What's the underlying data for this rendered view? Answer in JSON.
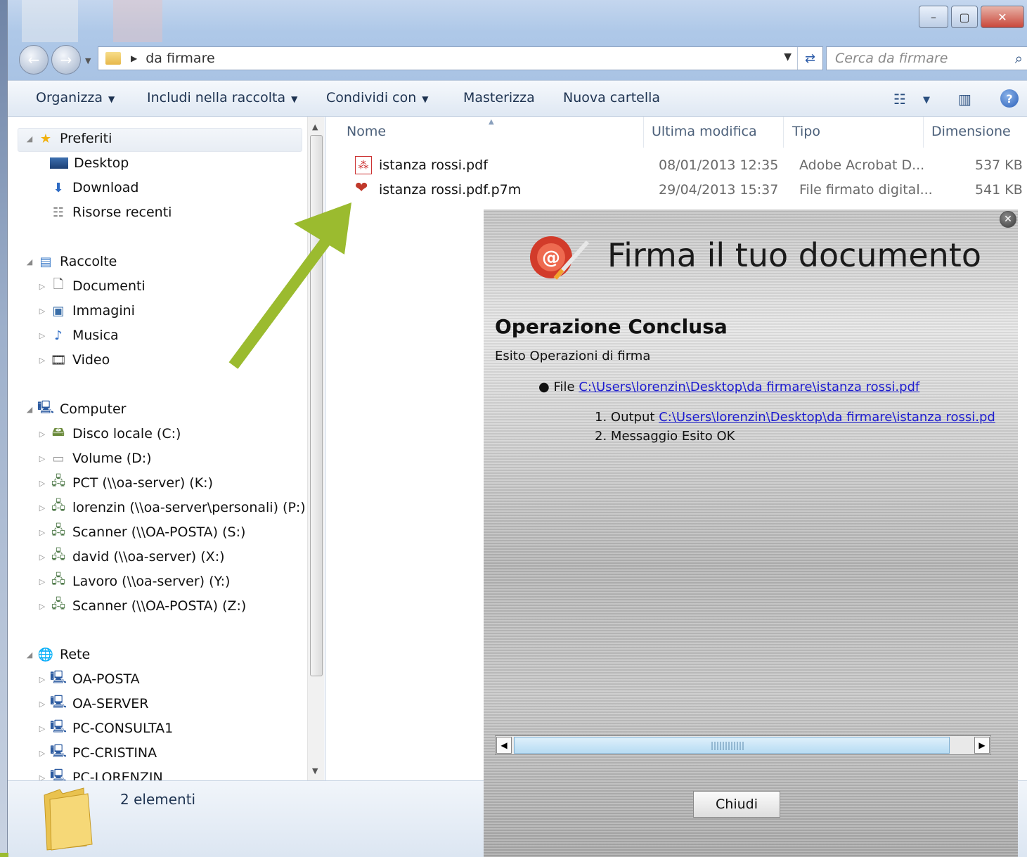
{
  "window": {
    "address_folder": "da firmare",
    "search_placeholder": "Cerca da firmare"
  },
  "toolbar": {
    "organize": "Organizza",
    "include": "Includi nella raccolta",
    "share": "Condividi con",
    "burn": "Masterizza",
    "new_folder": "Nuova cartella"
  },
  "nav": {
    "favorites": "Preferiti",
    "desktop": "Desktop",
    "download": "Download",
    "recent": "Risorse recenti",
    "libraries": "Raccolte",
    "documents": "Documenti",
    "pictures": "Immagini",
    "music": "Musica",
    "video": "Video",
    "computer": "Computer",
    "drives": [
      "Disco locale (C:)",
      "Volume (D:)",
      "PCT (\\\\oa-server) (K:)",
      "lorenzin (\\\\oa-server\\personali) (P:)",
      "Scanner (\\\\OA-POSTA) (S:)",
      "david (\\\\oa-server) (X:)",
      "Lavoro (\\\\oa-server) (Y:)",
      "Scanner (\\\\OA-POSTA) (Z:)"
    ],
    "network": "Rete",
    "hosts": [
      "OA-POSTA",
      "OA-SERVER",
      "PC-CONSULTA1",
      "PC-CRISTINA",
      "PC-LORENZIN"
    ]
  },
  "columns": {
    "name": "Nome",
    "modified": "Ultima modifica",
    "type": "Tipo",
    "size": "Dimensione"
  },
  "files": [
    {
      "name": "istanza rossi.pdf",
      "modified": "08/01/2013 12:35",
      "type": "Adobe Acrobat D...",
      "size": "537 KB",
      "icon": "pdf-icon"
    },
    {
      "name": "istanza rossi.pdf.p7m",
      "modified": "29/04/2013 15:37",
      "type": "File firmato digital...",
      "size": "541 KB",
      "icon": "signed-file-icon"
    }
  ],
  "status": {
    "count": "2 elementi"
  },
  "dialog": {
    "title": "Firma il tuo documento",
    "heading": "Operazione Conclusa",
    "subheading": "Esito Operazioni di firma",
    "file_label": "File",
    "file_path": "C:\\Users\\lorenzin\\Desktop\\da firmare\\istanza rossi.pdf",
    "item1_num": "1.",
    "item1_label": "Output",
    "item1_path": "C:\\Users\\lorenzin\\Desktop\\da firmare\\istanza rossi.pd",
    "item2_num": "2.",
    "item2_text": "Messaggio Esito OK",
    "close_button": "Chiudi"
  },
  "colors": {
    "arrow": "#9bbb2f",
    "link": "#1d1ccf"
  }
}
